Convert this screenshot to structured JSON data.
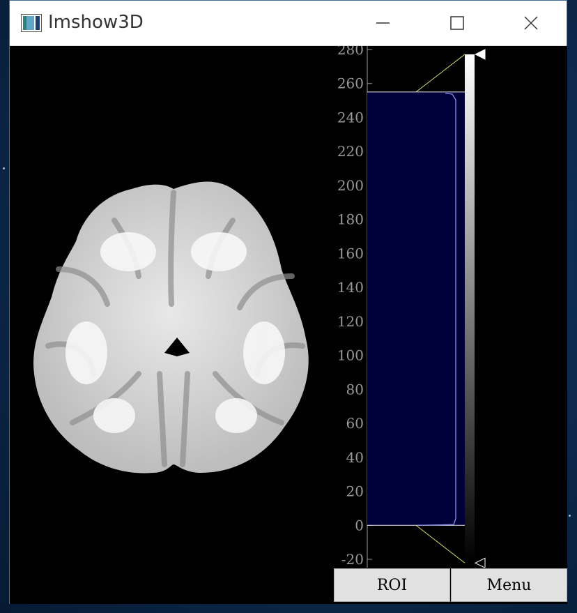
{
  "window": {
    "title": "Imshow3D",
    "controls": [
      "minimize-icon",
      "maximize-icon",
      "close-icon"
    ]
  },
  "viewport": {
    "content": "axial-brain-slice"
  },
  "histogram": {
    "y_ticks": [
      "280",
      "260",
      "240",
      "220",
      "200",
      "180",
      "160",
      "140",
      "120",
      "100",
      "80",
      "60",
      "40",
      "20",
      "0",
      "-20"
    ],
    "level_upper": 255,
    "level_lower": 0,
    "colors": {
      "region": "#00003a",
      "line": "#9a9aff",
      "axis": "#9a9a9a",
      "connector": "#d8d870"
    }
  },
  "buttons": {
    "roi_label": "ROI",
    "menu_label": "Menu"
  }
}
